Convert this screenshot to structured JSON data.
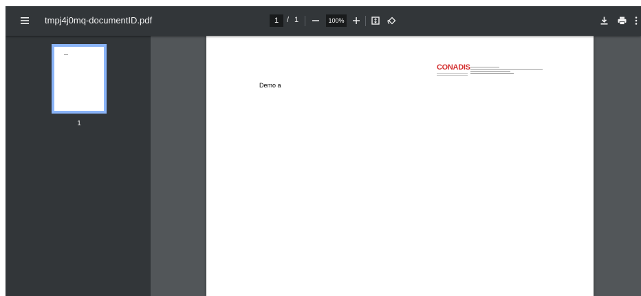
{
  "toolbar": {
    "title": "tmpj4j0mq-documentID.pdf",
    "page_current": "1",
    "page_separator": "/",
    "page_total": "1",
    "zoom": "100%"
  },
  "sidebar": {
    "thumbnail_page_number": "1"
  },
  "document": {
    "body_text": "Demo a",
    "logo_text": "CONADIS"
  }
}
